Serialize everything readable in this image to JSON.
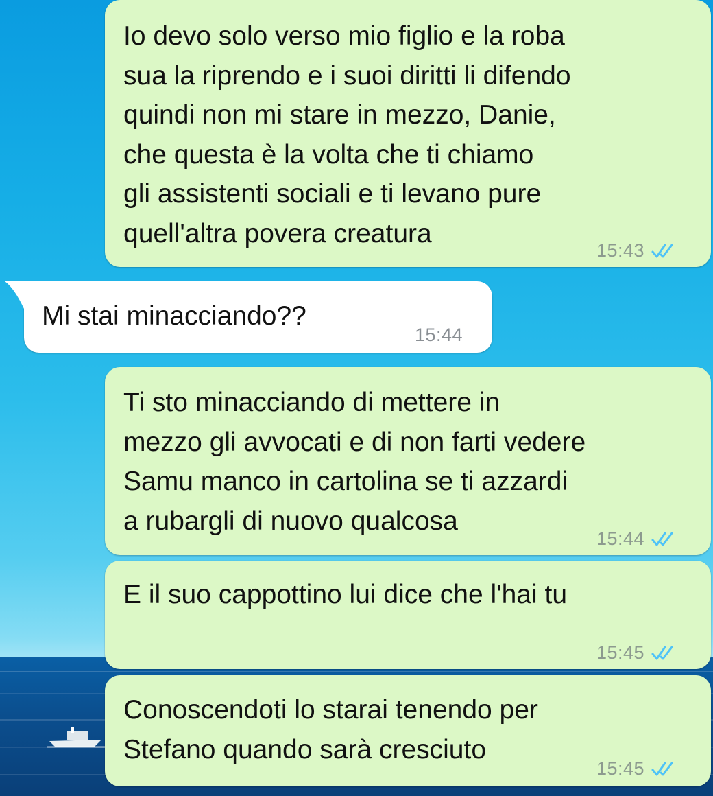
{
  "messages": [
    {
      "direction": "outgoing",
      "lines": [
        "Io devo solo verso mio figlio e la roba",
        "sua la riprendo e i suoi diritti li difendo",
        "quindi non mi stare in mezzo, Danie,",
        "che questa è la volta che ti chiamo",
        "gli assistenti sociali e ti levano pure",
        "quell'altra povera creatura"
      ],
      "text": "Io devo solo verso mio figlio e la roba\nsua la riprendo e i suoi diritti li difendo\nquindi non mi stare in mezzo, Danie,\nche questa è la volta che ti chiamo\ngli assistenti sociali e ti levano pure\nquell'altra povera creatura",
      "time": "15:43",
      "status": "read-double-tick"
    },
    {
      "direction": "incoming",
      "text": "Mi stai minacciando??",
      "time": "15:44"
    },
    {
      "direction": "outgoing",
      "text": "Ti sto minacciando di mettere in\nmezzo gli avvocati e di non farti vedere\nSamu manco in cartolina se ti azzardi\na rubargli di nuovo qualcosa",
      "time": "15:44",
      "status": "read-double-tick"
    },
    {
      "direction": "outgoing",
      "text": "E il suo cappottino lui dice che l'hai tu",
      "time": "15:45",
      "status": "read-double-tick"
    },
    {
      "direction": "outgoing",
      "text": "Conoscendoti lo starai tenendo per\nStefano quando sarà cresciuto",
      "time": "15:45",
      "status": "read-double-tick"
    }
  ],
  "colors": {
    "outgoing_bubble": "#dcf8c6",
    "incoming_bubble": "#ffffff",
    "read_tick": "#4fc3f7",
    "timestamp": "#8c9a8f"
  },
  "icons": {
    "read_receipt": "double-check-icon"
  }
}
